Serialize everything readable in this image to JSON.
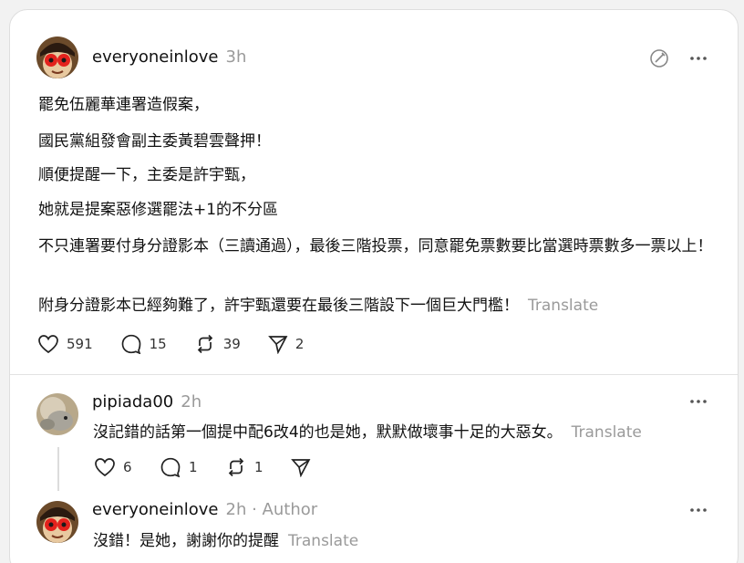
{
  "post": {
    "username": "everyoneinlove",
    "time": "3h",
    "paragraphs": [
      "罷免伍麗華連署造假案，",
      "國民黨組發會副主委黃碧雲聲押！",
      "順便提醒一下，主委是許宇甄，",
      "她就是提案惡修選罷法+1的不分區",
      "不只連署要付身分證影本（三讀通過），最後三階投票，同意罷免票數要比當選時票數多一票以上！",
      "附身分證影本已經夠難了，許宇甄還要在最後三階設下一個巨大門檻！"
    ],
    "translate_label": "Translate",
    "likes": "591",
    "comments": "15",
    "reposts": "39",
    "shares": "2"
  },
  "reply1": {
    "username": "pipiada00",
    "time": "2h",
    "text": "沒記錯的話第一個提中配6改4的也是她，默默做壞事十足的大惡女。",
    "translate_label": "Translate",
    "likes": "6",
    "comments": "1",
    "reposts": "1"
  },
  "reply2": {
    "username": "everyoneinlove",
    "time": "2h",
    "author_tag": "· Author",
    "text": "沒錯！是她，謝謝你的提醒",
    "translate_label": "Translate"
  },
  "icons": {
    "like": "heart-icon",
    "comment": "comment-bubble-icon",
    "repost": "repost-icon",
    "share": "send-icon",
    "more": "more-dots-icon",
    "edit": "edit-circle-icon"
  }
}
